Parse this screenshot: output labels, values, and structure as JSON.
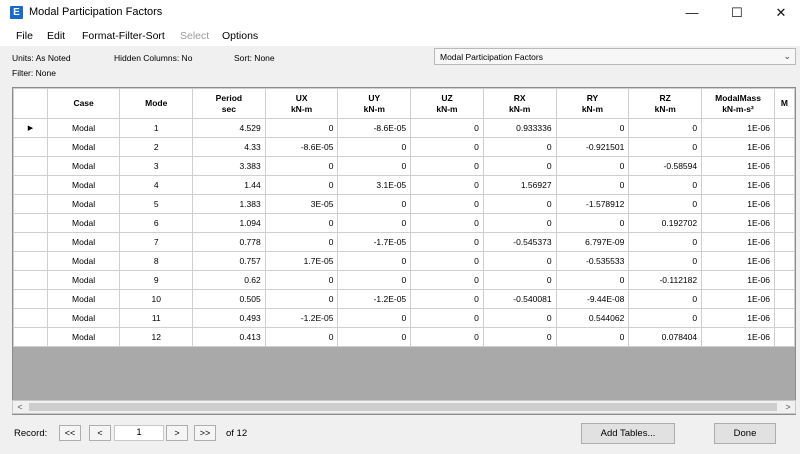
{
  "window": {
    "title": "Modal Participation Factors",
    "app_icon": "E",
    "minimize": "—",
    "maximize": "☐",
    "close": "✕"
  },
  "menu": {
    "file": "File",
    "edit": "Edit",
    "format": "Format-Filter-Sort",
    "select": "Select",
    "options": "Options"
  },
  "info": {
    "units": "Units: As Noted",
    "hidden": "Hidden Columns: No",
    "sort": "Sort: None",
    "filter": "Filter: None"
  },
  "table_selector": {
    "value": "Modal Participation Factors",
    "arrow": "⌄"
  },
  "grid": {
    "headers": [
      {
        "l1": "Case",
        "l2": ""
      },
      {
        "l1": "Mode",
        "l2": ""
      },
      {
        "l1": "Period",
        "l2": "sec"
      },
      {
        "l1": "UX",
        "l2": "kN-m"
      },
      {
        "l1": "UY",
        "l2": "kN-m"
      },
      {
        "l1": "UZ",
        "l2": "kN-m"
      },
      {
        "l1": "RX",
        "l2": "kN-m"
      },
      {
        "l1": "RY",
        "l2": "kN-m"
      },
      {
        "l1": "RZ",
        "l2": "kN-m"
      },
      {
        "l1": "ModalMass",
        "l2": "kN-m-s²"
      },
      {
        "l1": "M",
        "l2": ""
      }
    ],
    "selected_row_marker": "▶",
    "rows": [
      [
        "Modal",
        "1",
        "4.529",
        "0",
        "-8.6E-05",
        "0",
        "0.933336",
        "0",
        "0",
        "1E-06",
        ""
      ],
      [
        "Modal",
        "2",
        "4.33",
        "-8.6E-05",
        "0",
        "0",
        "0",
        "-0.921501",
        "0",
        "1E-06",
        ""
      ],
      [
        "Modal",
        "3",
        "3.383",
        "0",
        "0",
        "0",
        "0",
        "0",
        "-0.58594",
        "1E-06",
        ""
      ],
      [
        "Modal",
        "4",
        "1.44",
        "0",
        "3.1E-05",
        "0",
        "1.56927",
        "0",
        "0",
        "1E-06",
        ""
      ],
      [
        "Modal",
        "5",
        "1.383",
        "3E-05",
        "0",
        "0",
        "0",
        "-1.578912",
        "0",
        "1E-06",
        ""
      ],
      [
        "Modal",
        "6",
        "1.094",
        "0",
        "0",
        "0",
        "0",
        "0",
        "0.192702",
        "1E-06",
        ""
      ],
      [
        "Modal",
        "7",
        "0.778",
        "0",
        "-1.7E-05",
        "0",
        "-0.545373",
        "6.797E-09",
        "0",
        "1E-06",
        ""
      ],
      [
        "Modal",
        "8",
        "0.757",
        "1.7E-05",
        "0",
        "0",
        "0",
        "-0.535533",
        "0",
        "1E-06",
        ""
      ],
      [
        "Modal",
        "9",
        "0.62",
        "0",
        "0",
        "0",
        "0",
        "0",
        "-0.112182",
        "1E-06",
        ""
      ],
      [
        "Modal",
        "10",
        "0.505",
        "0",
        "-1.2E-05",
        "0",
        "-0.540081",
        "-9.44E-08",
        "0",
        "1E-06",
        ""
      ],
      [
        "Modal",
        "11",
        "0.493",
        "-1.2E-05",
        "0",
        "0",
        "0",
        "0.544062",
        "0",
        "1E-06",
        ""
      ],
      [
        "Modal",
        "12",
        "0.413",
        "0",
        "0",
        "0",
        "0",
        "0",
        "0.078404",
        "1E-06",
        ""
      ]
    ]
  },
  "scrollbar": {
    "left": "<",
    "right": ">"
  },
  "footer": {
    "record_label": "Record:",
    "first": "<<",
    "prev": "<",
    "record_value": "1",
    "next": ">",
    "last": ">>",
    "of_total": "of 12",
    "add_tables": "Add Tables...",
    "done": "Done"
  }
}
